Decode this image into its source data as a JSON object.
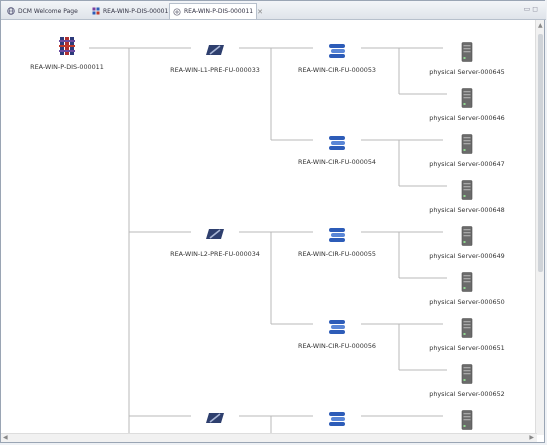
{
  "tabs": [
    {
      "label": "DCM Welcome Page",
      "icon": "globe-icon"
    },
    {
      "label": "REA-WIN-P-DIS-000011",
      "icon": "diagram-icon"
    },
    {
      "label": "REA-WIN-P-DIS-000011",
      "icon": "graph-icon",
      "active": true
    }
  ],
  "tree": {
    "root": {
      "label": "REA-WIN-P-DIS-000011",
      "icon": "cluster-root-icon"
    },
    "level1": [
      {
        "label": "REA-WIN-L1-PRE-FU-000033",
        "icon": "network-switch-icon"
      },
      {
        "label": "REA-WIN-L2-PRE-FU-000034",
        "icon": "network-switch-icon"
      },
      {
        "label": "",
        "icon": "network-switch-icon"
      }
    ],
    "level2": [
      {
        "label": "REA-WIN-CIR-FU-000053",
        "icon": "circuit-stack-icon"
      },
      {
        "label": "REA-WIN-CIR-FU-000054",
        "icon": "circuit-stack-icon"
      },
      {
        "label": "REA-WIN-CIR-FU-000055",
        "icon": "circuit-stack-icon"
      },
      {
        "label": "REA-WIN-CIR-FU-000056",
        "icon": "circuit-stack-icon"
      },
      {
        "label": "",
        "icon": "circuit-stack-icon"
      }
    ],
    "servers": [
      {
        "label": "physical Server-000645",
        "icon": "server-icon"
      },
      {
        "label": "physical Server-000646",
        "icon": "server-icon"
      },
      {
        "label": "physical Server-000647",
        "icon": "server-icon"
      },
      {
        "label": "physical Server-000648",
        "icon": "server-icon"
      },
      {
        "label": "physical Server-000649",
        "icon": "server-icon"
      },
      {
        "label": "physical Server-000650",
        "icon": "server-icon"
      },
      {
        "label": "physical Server-000651",
        "icon": "server-icon"
      },
      {
        "label": "physical Server-000652",
        "icon": "server-icon"
      },
      {
        "label": "",
        "icon": "server-icon"
      }
    ]
  },
  "colors": {
    "line": "#b9b9b9",
    "switch": "#2e3f6e",
    "circuit": "#2d5cb8",
    "server": "#6b6b6b"
  }
}
